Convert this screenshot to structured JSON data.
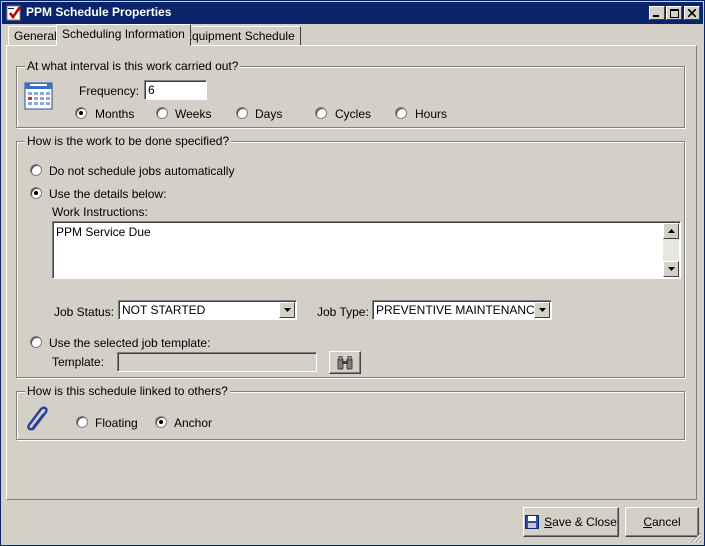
{
  "window": {
    "title": "PPM Schedule Properties"
  },
  "tabs": [
    {
      "label": "General",
      "active": false
    },
    {
      "label": "Scheduling Information",
      "active": true
    },
    {
      "label": "Equipment Schedule",
      "active": false
    }
  ],
  "interval": {
    "legend": "At what interval is this work carried out?",
    "frequency_label": "Frequency:",
    "frequency_value": "6",
    "options": [
      {
        "label": "Months",
        "selected": true
      },
      {
        "label": "Weeks",
        "selected": false
      },
      {
        "label": "Days",
        "selected": false
      },
      {
        "label": "Cycles",
        "selected": false
      },
      {
        "label": "Hours",
        "selected": false
      }
    ]
  },
  "work": {
    "legend": "How is the work to be done specified?",
    "option_no_auto": "Do not schedule jobs automatically",
    "option_details": "Use the details below:",
    "instructions_label": "Work Instructions:",
    "instructions_value": "PPM Service Due",
    "job_status_label": "Job Status:",
    "job_status_value": "NOT STARTED",
    "job_type_label": "Job Type:",
    "job_type_value": "PREVENTIVE MAINTENANCE",
    "option_template": "Use the selected job template:",
    "template_label": "Template:",
    "template_value": "",
    "selected_option": "details"
  },
  "linking": {
    "legend": "How is this schedule linked to others?",
    "options": [
      {
        "label": "Floating",
        "selected": false
      },
      {
        "label": "Anchor",
        "selected": true
      }
    ]
  },
  "footer": {
    "save_prefix": "S",
    "save_rest": "ave & Close",
    "cancel_prefix": "C",
    "cancel_rest": "ancel"
  },
  "colors": {
    "titlebar": "#0a246a",
    "face": "#d4d0c8"
  }
}
